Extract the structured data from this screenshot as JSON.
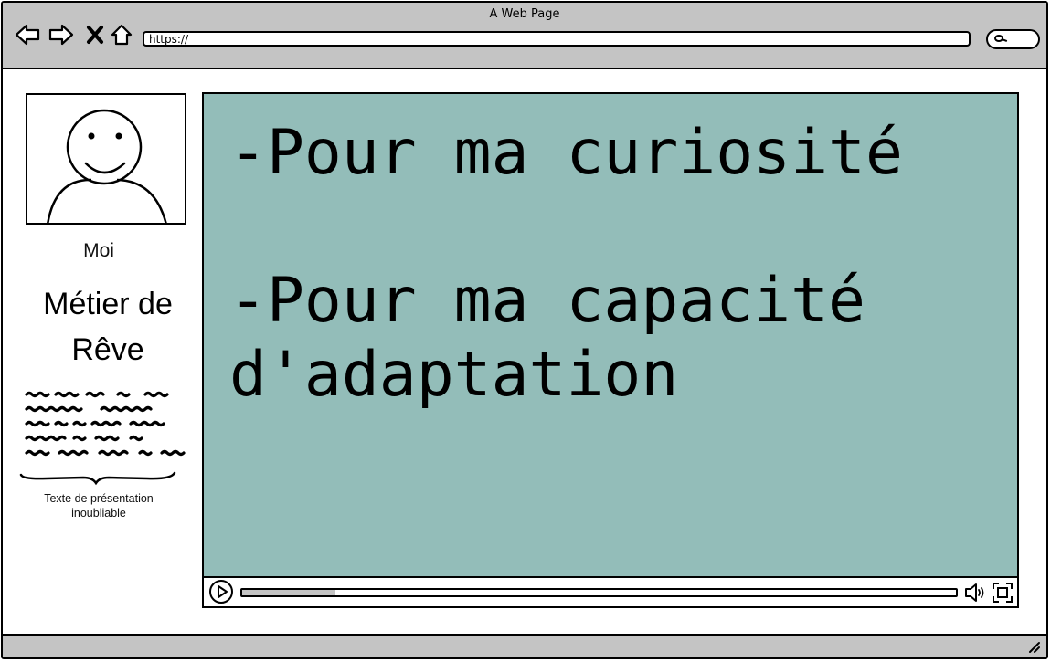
{
  "window": {
    "title": "A Web Page",
    "url": "https://"
  },
  "icons": {
    "back": "back-arrow-icon",
    "forward": "forward-arrow-icon",
    "stop": "close-icon",
    "home": "home-icon",
    "search": "search-icon"
  },
  "sidebar": {
    "caption": "Moi",
    "heading": "Métier de Rêve",
    "presentation_note": "Texte de présentation inoubliable"
  },
  "video": {
    "lines": [
      "-Pour ma curiosité",
      "",
      "-Pour ma capacité",
      "d'adaptation"
    ],
    "progress_fraction": 0.13,
    "background_color": "#93bdb9"
  },
  "colors": {
    "chrome": "#c4c4c4",
    "video_screen": "#93bdb9",
    "outline": "#000000"
  }
}
